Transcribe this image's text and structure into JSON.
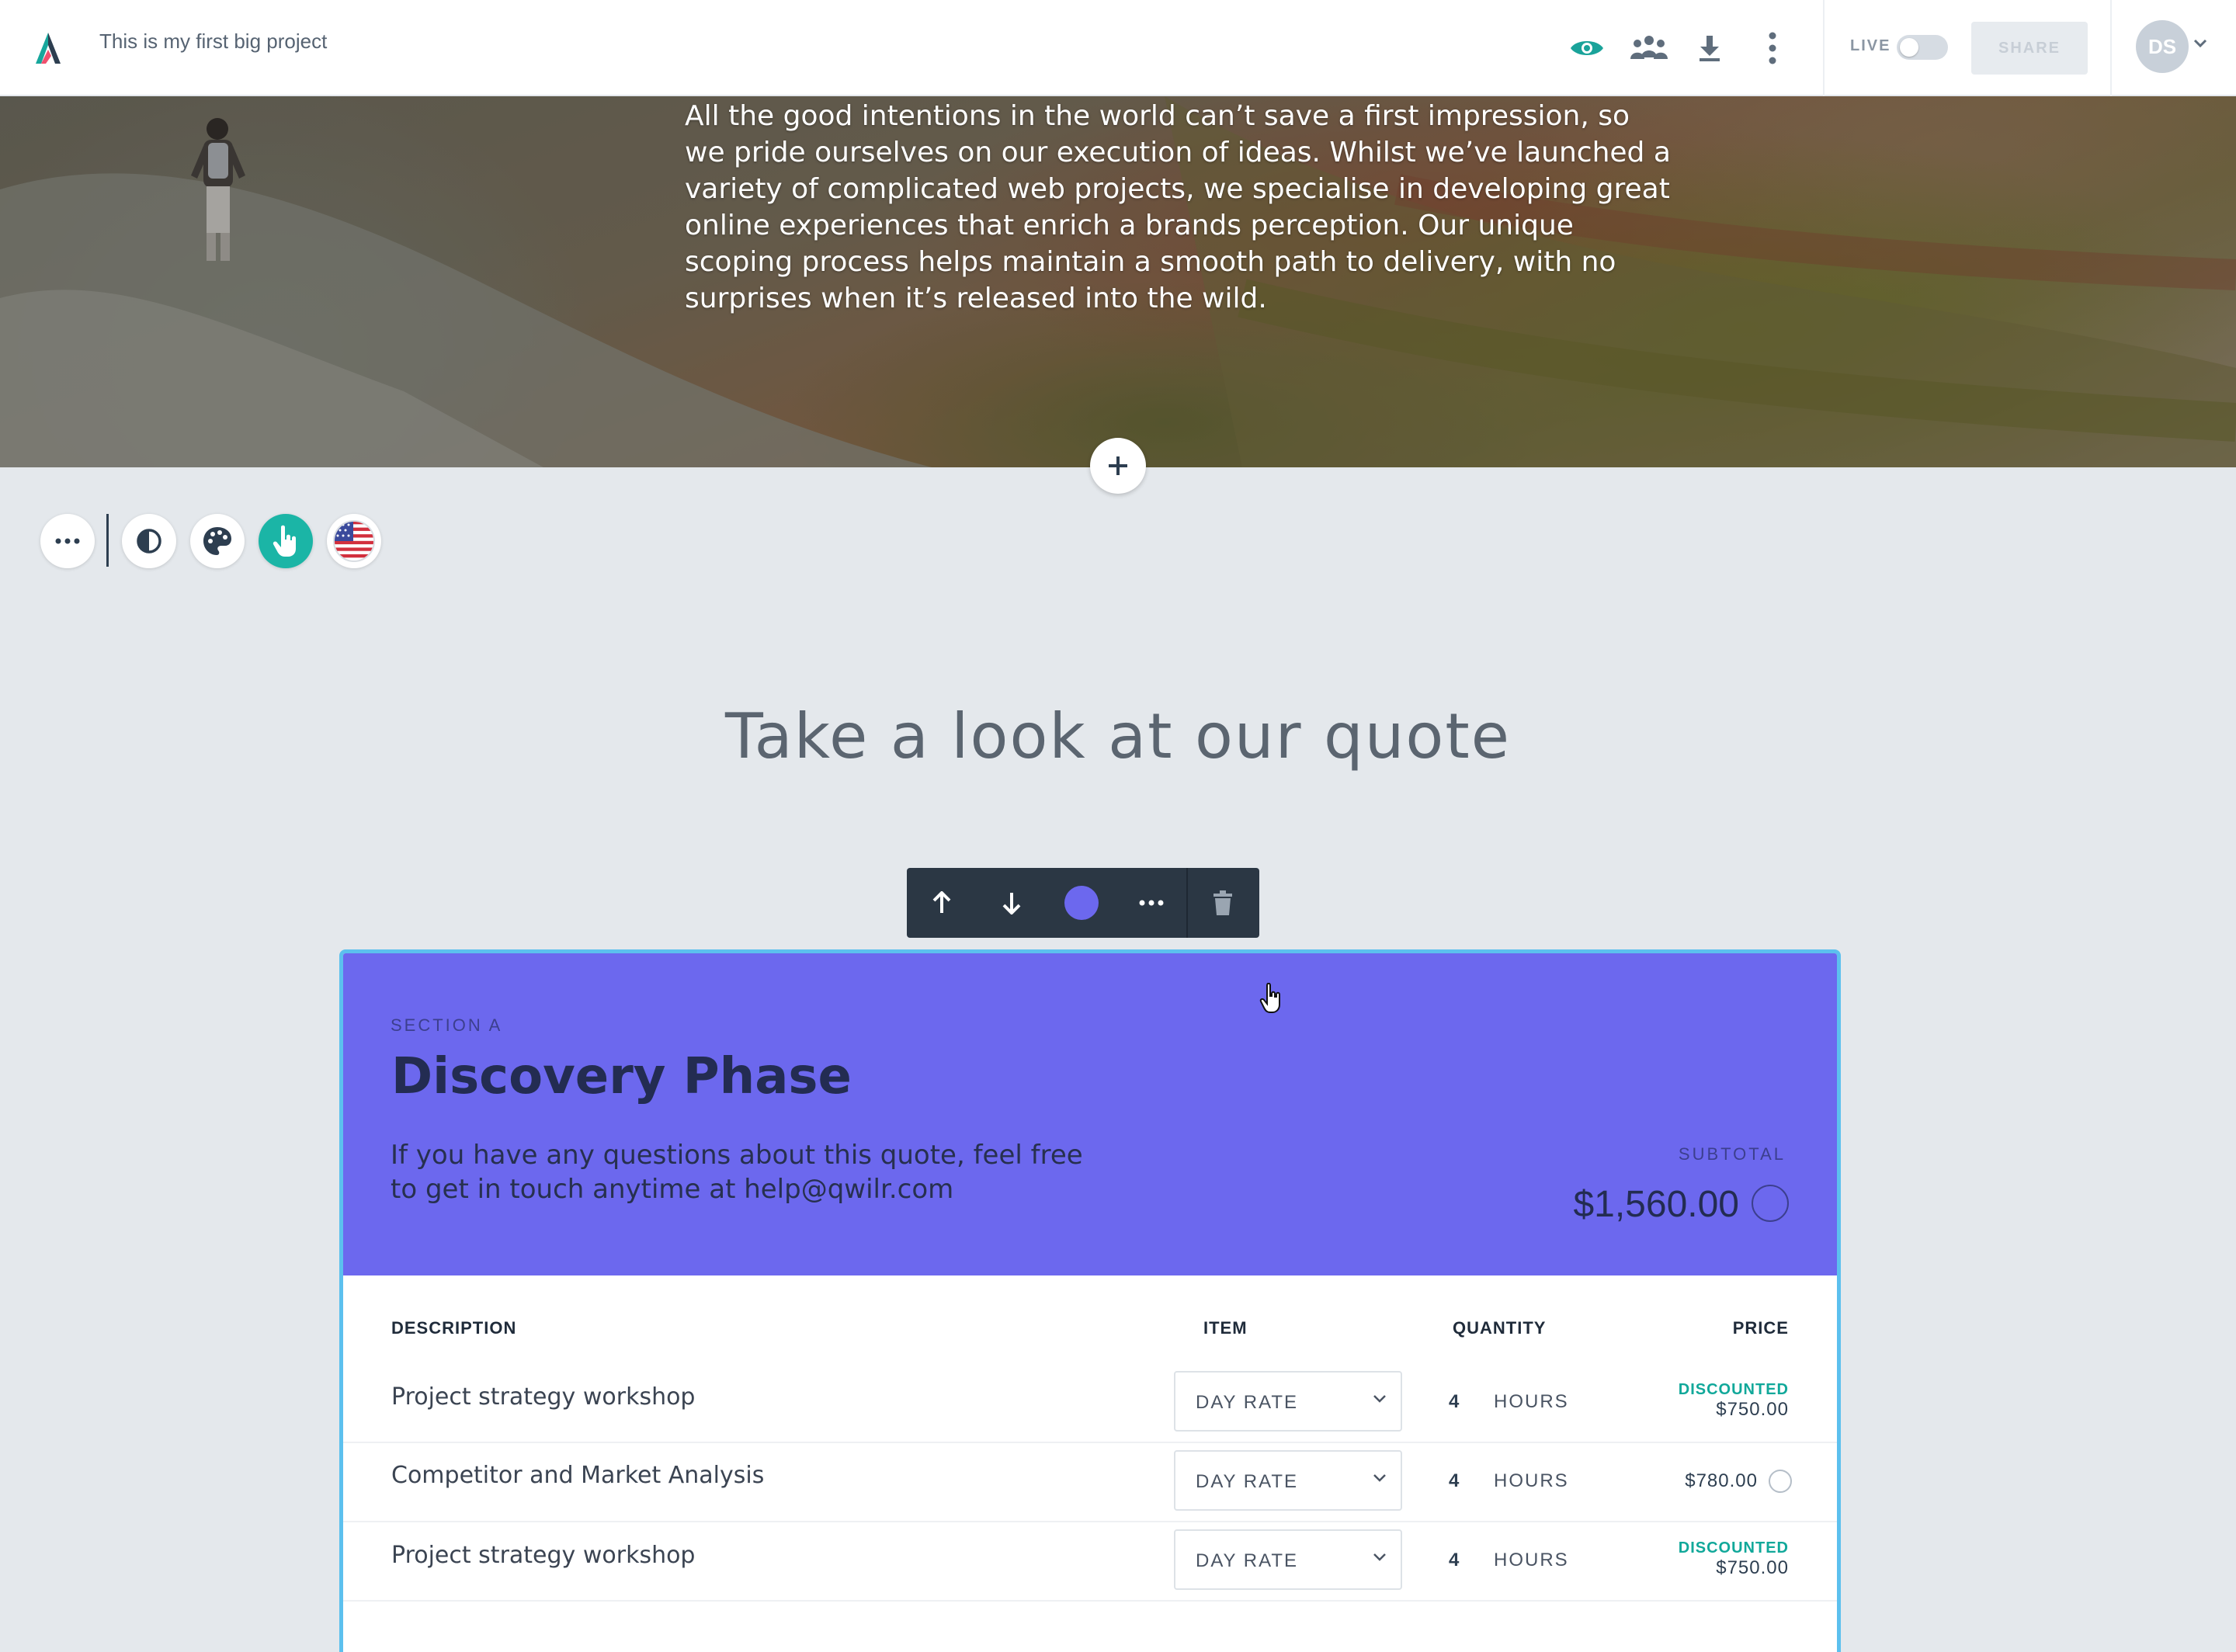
{
  "topbar": {
    "project_title": "This is my first big project",
    "icons": [
      "eye-icon",
      "team-icon",
      "download-icon",
      "more-vertical-icon"
    ],
    "live_label": "LIVE",
    "live_enabled": false,
    "share_label": "SHARE",
    "avatar_initials": "DS",
    "accent_color": "#1aa39a"
  },
  "hero": {
    "text": "All the good intentions in the world can’t save a first impression, so we pride ourselves on our execution of ideas. Whilst we’ve launched a variety of complicated web projects, we specialise in developing great online experiences that enrich a brands perception. Our unique scoping process helps maintain a smooth path to delivery, with no surprises when it’s released into the wild."
  },
  "tools": [
    "more-icon",
    "contrast-icon",
    "palette-icon",
    "pointer-icon",
    "us-flag-icon"
  ],
  "quote": {
    "heading": "Take a look at our quote",
    "block_toolbar": [
      "move-up-icon",
      "move-down-icon",
      "color-dot-icon",
      "more-icon",
      "delete-icon"
    ],
    "section_label": "SECTION A",
    "section_title": "Discovery Phase",
    "description": "If you have any questions about this quote, feel free to get in touch anytime at help@qwilr.com",
    "subtotal_label": "SUBTOTAL",
    "subtotal_value": "$1,560.00",
    "header_color": "#6c68ee",
    "columns": {
      "description": "DESCRIPTION",
      "item": "ITEM",
      "quantity": "QUANTITY",
      "price": "PRICE"
    },
    "rows": [
      {
        "description": "Project strategy workshop",
        "item": "DAY RATE",
        "quantity": "4",
        "unit": "HOURS",
        "badge": "DISCOUNTED",
        "price": "$750.00"
      },
      {
        "description": "Competitor and Market Analysis",
        "item": "DAY RATE",
        "quantity": "4",
        "unit": "HOURS",
        "badge": "",
        "price": "$780.00"
      },
      {
        "description": "Project strategy workshop",
        "item": "DAY RATE",
        "quantity": "4",
        "unit": "HOURS",
        "badge": "DISCOUNTED",
        "price": "$750.00"
      }
    ]
  }
}
